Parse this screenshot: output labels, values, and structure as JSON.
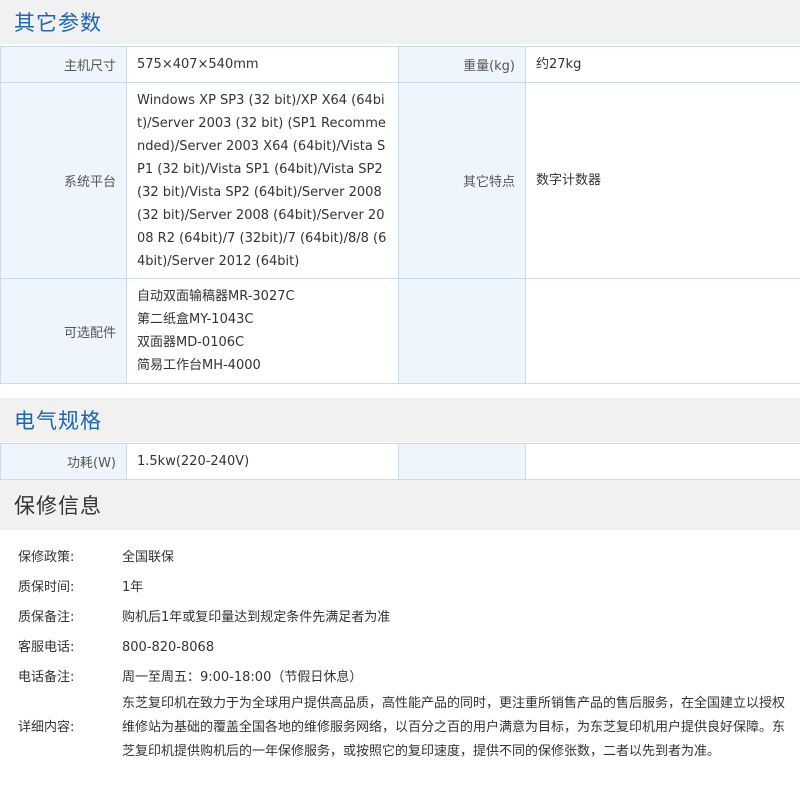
{
  "other_params": {
    "title": "其它参数",
    "rows": [
      {
        "label1": "主机尺寸",
        "value1": "575×407×540mm",
        "label2": "重量(kg)",
        "value2": "约27kg"
      },
      {
        "label1": "系统平台",
        "value1": "Windows XP SP3 (32 bit)/XP X64 (64bit)/Server 2003 (32 bit) (SP1 Recommended)/Server 2003 X64 (64bit)/Vista SP1 (32 bit)/Vista SP1 (64bit)/Vista SP2 (32 bit)/Vista SP2 (64bit)/Server 2008 (32 bit)/Server 2008 (64bit)/Server 2008 R2 (64bit)/7 (32bit)/7 (64bit)/8/8 (64bit)/Server 2012 (64bit)",
        "label2": "其它特点",
        "value2": "数字计数器"
      },
      {
        "label1": "可选配件",
        "value1_lines": [
          "自动双面输稿器MR-3027C",
          "第二纸盒MY-1043C",
          "双面器MD-0106C",
          "简易工作台MH-4000"
        ],
        "label2": "",
        "value2": ""
      }
    ]
  },
  "electrical": {
    "title": "电气规格",
    "rows": [
      {
        "label1": "功耗(W)",
        "value1": "1.5kw(220-240V)",
        "label2": "",
        "value2": ""
      }
    ]
  },
  "warranty": {
    "title": "保修信息",
    "items": [
      {
        "key": "保修政策:",
        "value": "全国联保"
      },
      {
        "key": "质保时间:",
        "value": "1年"
      },
      {
        "key": "质保备注:",
        "value": "购机后1年或复印量达到规定条件先满足者为准"
      },
      {
        "key": "客服电话:",
        "value": "800-820-8068"
      },
      {
        "key": "电话备注:",
        "value": "周一至周五：9:00-18:00（节假日休息）"
      },
      {
        "key": "详细内容:",
        "value": "东芝复印机在致力于为全球用户提供高品质，高性能产品的同时，更注重所销售产品的售后服务，在全国建立以授权维修站为基础的覆盖全国各地的维修服务网络，以百分之百的用户满意为目标，为东芝复印机用户提供良好保障。东芝复印机提供购机后的一年保修服务，或按照它的复印速度，提供不同的保修张数，二者以先到者为准。"
      }
    ]
  }
}
